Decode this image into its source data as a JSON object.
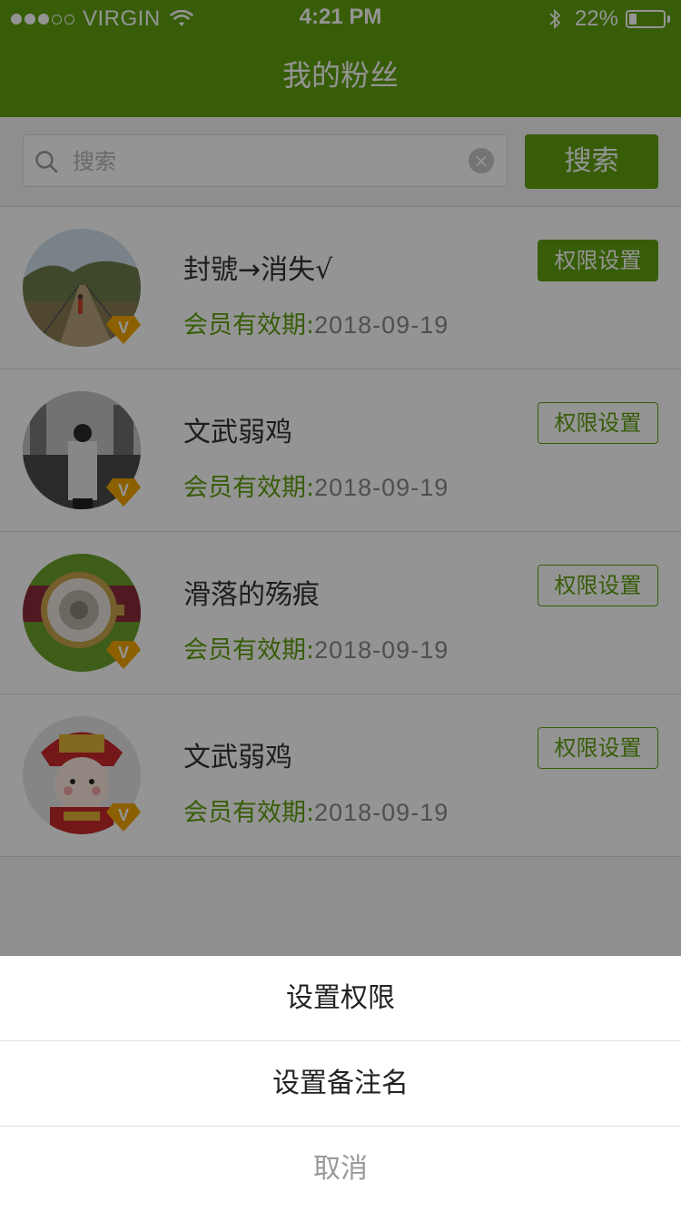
{
  "status_bar": {
    "carrier": "VIRGIN",
    "signal_bars": 3,
    "signal_total": 5,
    "time": "4:21 PM",
    "battery_percent": "22%",
    "battery_level": 0.22
  },
  "header": {
    "title": "我的粉丝"
  },
  "search": {
    "placeholder": "搜索",
    "button_label": "搜索"
  },
  "fans": [
    {
      "name": "封號→消失√",
      "expiry_label": "会员有效期:",
      "expiry_date": "2018-09-19",
      "button_label": "权限设置",
      "selected": true
    },
    {
      "name": "文武弱鸡",
      "expiry_label": "会员有效期:",
      "expiry_date": "2018-09-19",
      "button_label": "权限设置",
      "selected": false
    },
    {
      "name": "滑落的殇痕",
      "expiry_label": "会员有效期:",
      "expiry_date": "2018-09-19",
      "button_label": "权限设置",
      "selected": false
    },
    {
      "name": "文武弱鸡",
      "expiry_label": "会员有效期:",
      "expiry_date": "2018-09-19",
      "button_label": "权限设置",
      "selected": false
    }
  ],
  "action_sheet": {
    "items": [
      "设置权限",
      "设置备注名"
    ],
    "cancel_label": "取消"
  },
  "colors": {
    "accent": "#5fa10f",
    "badge": "#f2a600"
  }
}
